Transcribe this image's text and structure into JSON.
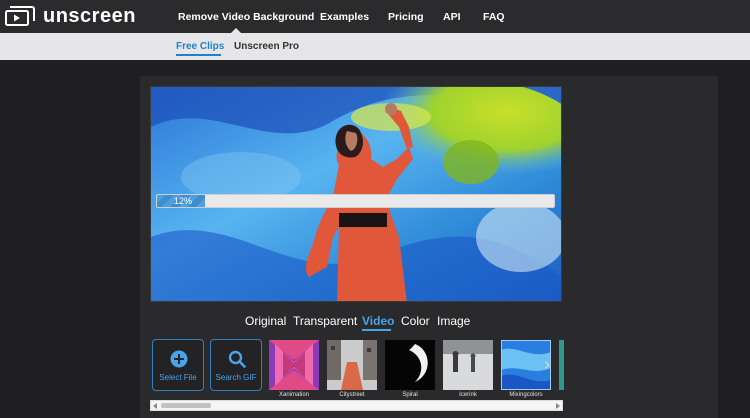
{
  "header": {
    "brand": "unscreen",
    "nav": [
      "Remove Video Background",
      "Examples",
      "Pricing",
      "API",
      "FAQ"
    ]
  },
  "subnav": {
    "items": [
      "Free Clips",
      "Unscreen Pro"
    ],
    "active": "Free Clips"
  },
  "video": {
    "progress_label": "12%",
    "progress_fraction": 0.12
  },
  "tabs": {
    "items": [
      "Original",
      "Transparent",
      "Video",
      "Color",
      "Image"
    ],
    "active": "Video"
  },
  "clips": {
    "select_file_label": "Select File",
    "search_gif_label": "Search GIF",
    "thumbnails": [
      "Xanimation",
      "Citystreet",
      "Spiral",
      "Icerink",
      "Mixingcolors"
    ]
  },
  "colors": {
    "accent": "#4aa3e8",
    "topbar": "#2b2b2d",
    "subbar": "#e6e6e8",
    "background": "#1f1f21"
  },
  "icons": {
    "logo": "play-window-icon",
    "select_file": "plus-circle-icon",
    "search_gif": "search-icon",
    "next": "chevron-right-icon"
  }
}
